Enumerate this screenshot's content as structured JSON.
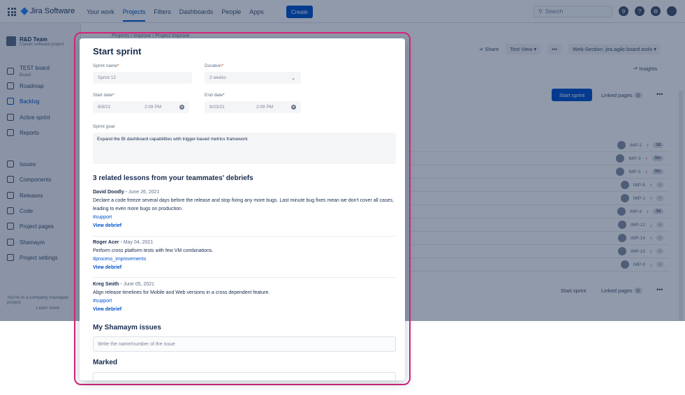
{
  "topbar": {
    "product": "Jira Software",
    "nav": [
      "Your work",
      "Projects",
      "Filters",
      "Dashboards",
      "People",
      "Apps"
    ],
    "active_nav": "Projects",
    "create": "Create",
    "search_placeholder": "Search",
    "notification_count": "9",
    "help": "?"
  },
  "sidebar": {
    "project_name": "R&D Team",
    "project_type": "Classic software project",
    "board_name": "TEST board",
    "board_sub": "Board",
    "items": [
      "Roadmap",
      "Backlog",
      "Active sprint",
      "Reports",
      "Issues",
      "Components",
      "Releases",
      "Code",
      "Project pages",
      "Shamaym",
      "Project settings"
    ],
    "active_item": "Backlog",
    "footer": "You're in a company-managed project",
    "learn_more": "Learn more"
  },
  "board": {
    "breadcrumb": "Projects  /  Improve  /  Project Improve",
    "share": "Share",
    "test_view": "Test View",
    "more": "•••",
    "web_section": "Web-Section: jira.agile.board.tools",
    "insights": "Insights",
    "start_sprint": "Start sprint",
    "linked_pages": "Linked pages",
    "linked_count": "0",
    "issues": [
      {
        "key": "IMP-2",
        "est": "1d",
        "dir": "↑"
      },
      {
        "key": "IMP-3",
        "est": "0m",
        "dir": "↑"
      },
      {
        "key": "IMP-5",
        "est": "0m",
        "dir": "↑"
      },
      {
        "key": "IMP-8",
        "est": "-",
        "dir": "↑"
      },
      {
        "key": "IMP-1",
        "est": "-",
        "dir": "↑"
      },
      {
        "key": "IMP-6",
        "est": "3d",
        "dir": "↑"
      },
      {
        "key": "IMP-12",
        "est": "-",
        "dir": "↓"
      },
      {
        "key": "IMP-14",
        "est": "-",
        "dir": "↑"
      },
      {
        "key": "IMP-15",
        "est": "-",
        "dir": "↑"
      },
      {
        "key": "IMP-9",
        "est": "-",
        "dir": "↓"
      }
    ],
    "start_sprint_2": "Start sprint",
    "linked_pages_2": "Linked pages",
    "linked_count_2": "0"
  },
  "modal": {
    "title": "Start sprint",
    "sprint_name_label": "Sprint name",
    "sprint_name_value": "Sprint 12",
    "duration_label": "Duration",
    "duration_value": "2 weeks",
    "start_date_label": "Start date",
    "start_date_value": "8/9/21",
    "start_time_value": "2:09 PM",
    "end_date_label": "End date",
    "end_date_value": "8/23/21",
    "end_time_value": "2:09 PM",
    "goal_label": "Sprint goal",
    "goal_value": "Expand the BI dashboard capabilities with trigger-based metrics framework",
    "lessons_heading": "3 related lessons from your teammates' debriefs",
    "lessons": [
      {
        "author": "David Doodly",
        "date": "June 26, 2021",
        "text": "Declare a code freeze several days before the release and stop fixing any more bugs. Last minute bug fixes mean we don't cover all cases, leading to even more bugs on production.",
        "tag": "#support",
        "link": "View debrief"
      },
      {
        "author": "Roger Acer",
        "date": "May 04, 2021",
        "text": "Perform cross platform tests with few VM combinations.",
        "tag": "#process_improvements",
        "link": "View debrief"
      },
      {
        "author": "Kreg Smith",
        "date": "June 05, 2021",
        "text": "Align release timelines for Mobile and Web versions in a cross dependent feature.",
        "tag": "#support",
        "link": "View debrief"
      }
    ],
    "my_issues_heading": "My Shamaym issues",
    "my_issues_placeholder": "Write the name/number of the issue",
    "marked_heading": "Marked"
  },
  "colors": {
    "accent": "#0052cc",
    "highlight": "#d6247a",
    "overlay": "#091e42"
  }
}
